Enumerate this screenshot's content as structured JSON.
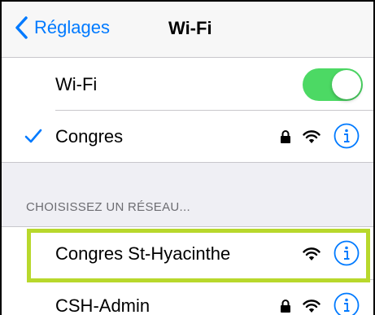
{
  "navbar": {
    "back_label": "Réglages",
    "title": "Wi-Fi"
  },
  "wifi_toggle": {
    "label": "Wi-Fi",
    "state": "on",
    "on_color": "#4cd964"
  },
  "connected_network": {
    "name": "Congres",
    "checked": true,
    "locked": true
  },
  "networks_section": {
    "header": "CHOISISSEZ UN RÉSEAU...",
    "items": [
      {
        "name": "Congres St-Hyacinthe",
        "locked": false,
        "highlighted": true
      },
      {
        "name": "CSH-Admin",
        "locked": true,
        "highlighted": false
      }
    ]
  },
  "colors": {
    "accent": "#007aff",
    "highlight": "#b8d82c",
    "background": "#efeff4"
  },
  "icons": {
    "back": "chevron-left-icon",
    "check": "checkmark-icon",
    "lock": "lock-icon",
    "wifi": "wifi-signal-icon",
    "info": "info-icon"
  }
}
